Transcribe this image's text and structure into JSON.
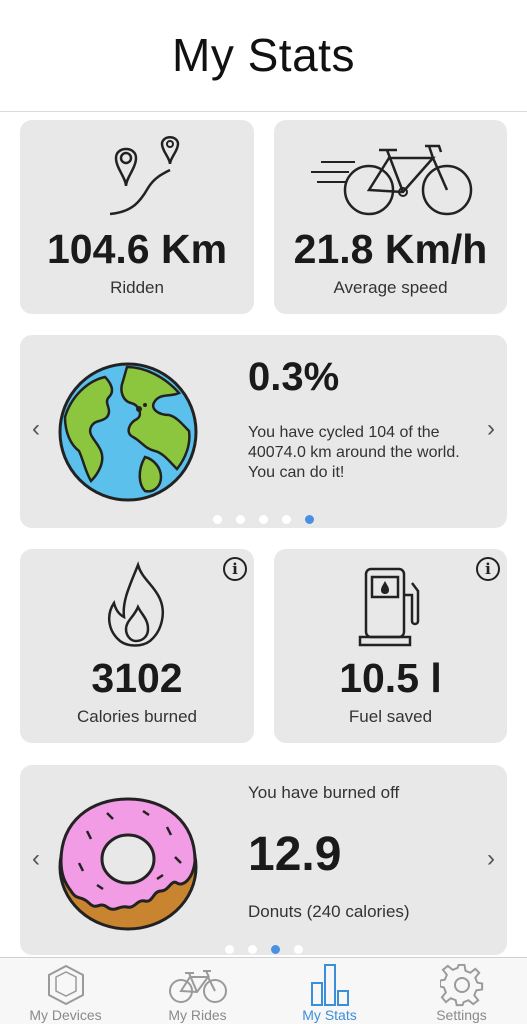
{
  "header": {
    "title": "My Stats"
  },
  "distance_card": {
    "value": "104.6 Km",
    "label": "Ridden",
    "icon": "map-route-icon"
  },
  "speed_card": {
    "value": "21.8 Km/h",
    "label": "Average speed",
    "icon": "bicycle-speed-icon"
  },
  "world_card": {
    "value": "0.3%",
    "text": "You have cycled 104 of the 40074.0 km around the world. You can do it!",
    "icon": "earth-icon",
    "prev": "‹",
    "next": "›",
    "pages": 5,
    "active_page": 5
  },
  "calories_card": {
    "value": "3102",
    "label": "Calories burned",
    "icon": "flame-icon",
    "info": "i"
  },
  "fuel_card": {
    "value": "10.5 l",
    "label": "Fuel saved",
    "icon": "fuel-pump-icon",
    "info": "i"
  },
  "donut_card": {
    "intro": "You have burned off",
    "value": "12.9",
    "label": "Donuts (240 calories)",
    "icon": "donut-icon",
    "prev": "‹",
    "next": "›",
    "pages": 4,
    "active_page": 3
  },
  "tabbar": {
    "tabs": [
      {
        "label": "My Devices",
        "icon": "device-hexagon-icon",
        "active": false
      },
      {
        "label": "My Rides",
        "icon": "bicycle-icon",
        "active": false
      },
      {
        "label": "My Stats",
        "icon": "bar-chart-icon",
        "active": true
      },
      {
        "label": "Settings",
        "icon": "gear-icon",
        "active": false
      }
    ]
  },
  "colors": {
    "accent": "#3b8fd8",
    "card": "#e8e8e8",
    "dot_active": "#4a90e2",
    "donut_icing": "#f29ce6",
    "donut_base": "#c8842e",
    "earth_ocean": "#5bc0eb",
    "earth_land": "#8cc63f"
  }
}
